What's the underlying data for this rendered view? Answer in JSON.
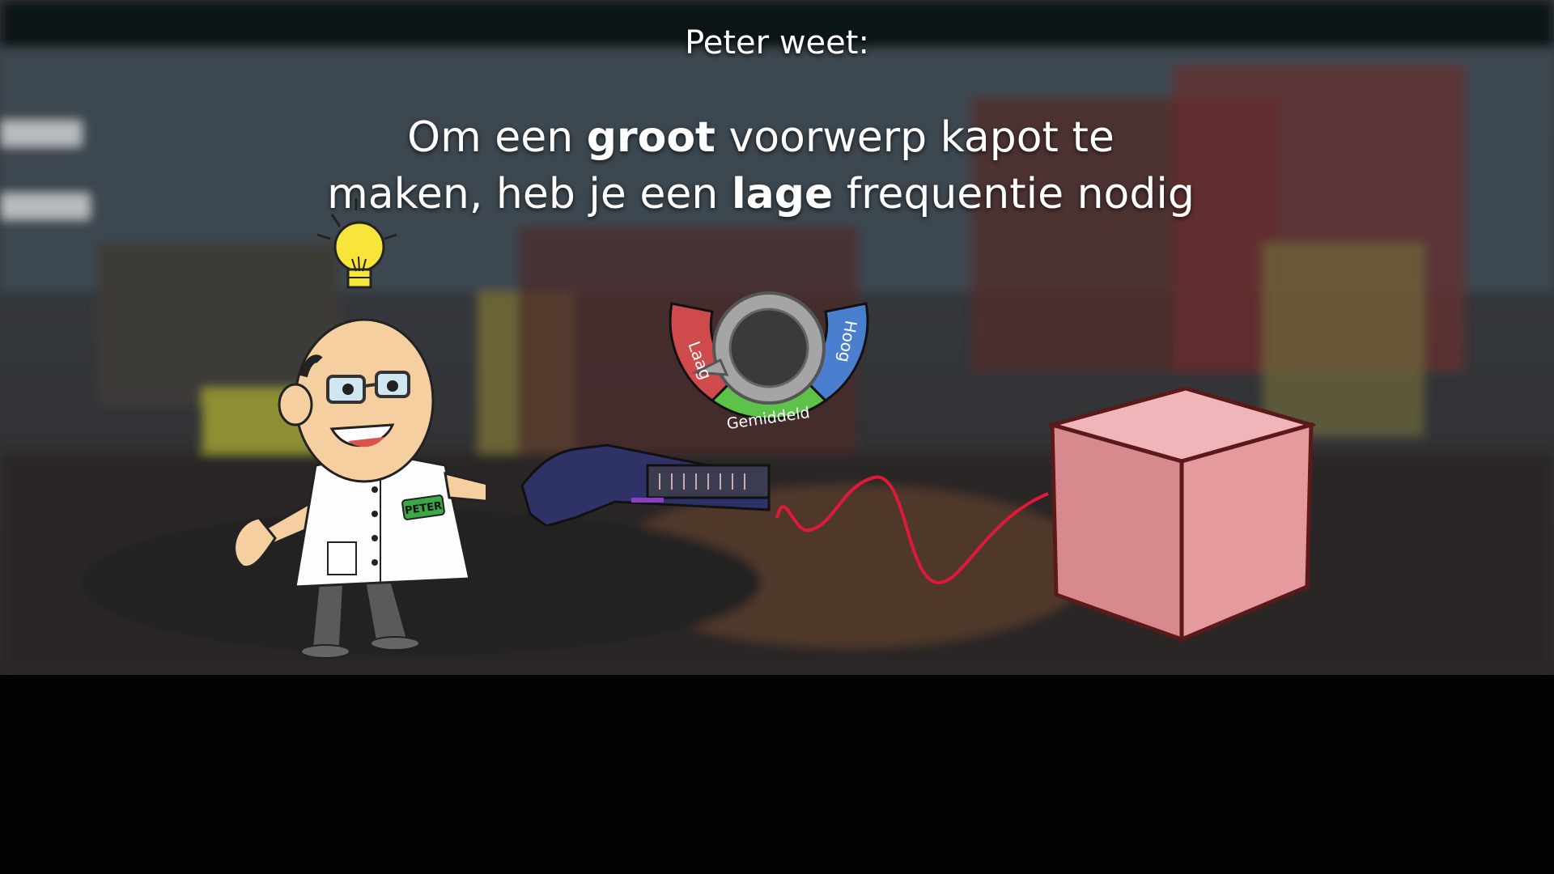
{
  "window": {
    "width": 1920,
    "height": 1080
  },
  "header": {
    "speaker_label": "Peter weet:"
  },
  "message": {
    "line1_pre": "Om een ",
    "line1_bold": "groot",
    "line1_post": " voorwerp kapot te",
    "line2_pre": "maken, heb je een ",
    "line2_bold": "lage",
    "line2_post": " frequentie nodig"
  },
  "character": {
    "badge_text": "PETER",
    "icon": "lightbulb-icon"
  },
  "dial": {
    "labels": {
      "low": "Laag",
      "mid": "Gemiddeld",
      "high": "Hoog"
    },
    "colors": {
      "low": "#cf4a4a",
      "mid": "#5cc24a",
      "high": "#4a7fcf"
    },
    "selected": "Laag"
  },
  "object": {
    "name": "cube",
    "color": "#e59a9e"
  },
  "wave": {
    "color": "#e0183a"
  }
}
